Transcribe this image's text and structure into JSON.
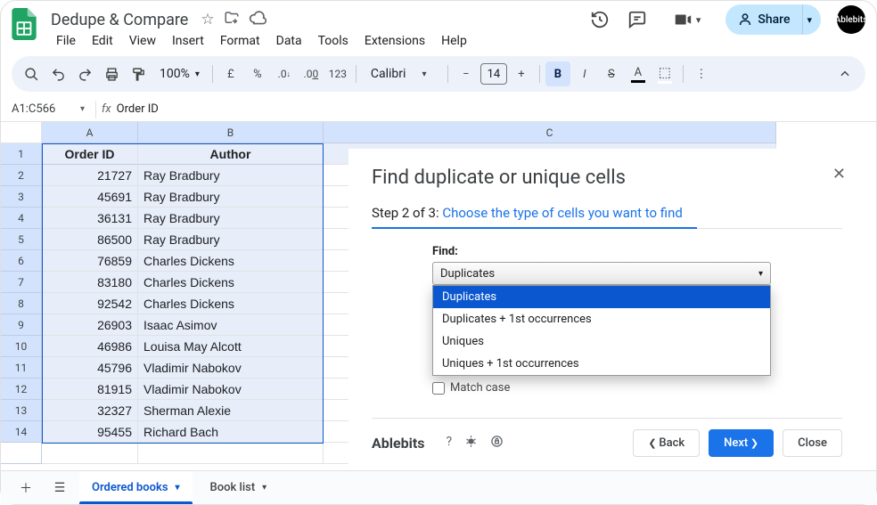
{
  "doc": {
    "title": "Dedupe & Compare"
  },
  "menu": {
    "file": "File",
    "edit": "Edit",
    "view": "View",
    "insert": "Insert",
    "format": "Format",
    "data": "Data",
    "tools": "Tools",
    "extensions": "Extensions",
    "help": "Help"
  },
  "toolbar": {
    "zoom": "100%",
    "font": "Calibri",
    "font_size": "14"
  },
  "share": {
    "label": "Share"
  },
  "avatar": {
    "text": "Ablebits"
  },
  "name_box": {
    "range": "A1:C566",
    "formula_text": "Order ID"
  },
  "columns": {
    "A": "A",
    "B": "B",
    "C": "C"
  },
  "header_row": {
    "A": "Order ID",
    "B": "Author"
  },
  "rows": [
    {
      "n": "1"
    },
    {
      "n": "2",
      "A": "21727",
      "B": "Ray Bradbury"
    },
    {
      "n": "3",
      "A": "45691",
      "B": "Ray Bradbury"
    },
    {
      "n": "4",
      "A": "36131",
      "B": "Ray Bradbury"
    },
    {
      "n": "5",
      "A": "86500",
      "B": "Ray Bradbury"
    },
    {
      "n": "6",
      "A": "76859",
      "B": "Charles Dickens"
    },
    {
      "n": "7",
      "A": "83180",
      "B": "Charles Dickens"
    },
    {
      "n": "8",
      "A": "92542",
      "B": "Charles Dickens"
    },
    {
      "n": "9",
      "A": "26903",
      "B": "Isaac Asimov"
    },
    {
      "n": "10",
      "A": "46986",
      "B": "Louisa May Alcott"
    },
    {
      "n": "11",
      "A": "45796",
      "B": "Vladimir Nabokov"
    },
    {
      "n": "12",
      "A": "81915",
      "B": "Vladimir Nabokov"
    },
    {
      "n": "13",
      "A": "32327",
      "B": "Sherman Alexie"
    },
    {
      "n": "14",
      "A": "95455",
      "B": "Richard Bach"
    }
  ],
  "sheets": {
    "tab1": "Ordered books",
    "tab2": "Book list"
  },
  "panel": {
    "title": "Find duplicate or unique cells",
    "step_prefix": "Step 2 of 3: ",
    "step_link": "Choose the type of cells you want to find",
    "find_label": "Find:",
    "selected": "Duplicates",
    "options": {
      "o1": "Duplicates",
      "o2": "Duplicates + 1st occurrences",
      "o3": "Uniques",
      "o4": "Uniques + 1st occurrences"
    },
    "match_case": "Match case",
    "brand": "Ablebits",
    "back": "Back",
    "next": "Next",
    "close": "Close"
  }
}
